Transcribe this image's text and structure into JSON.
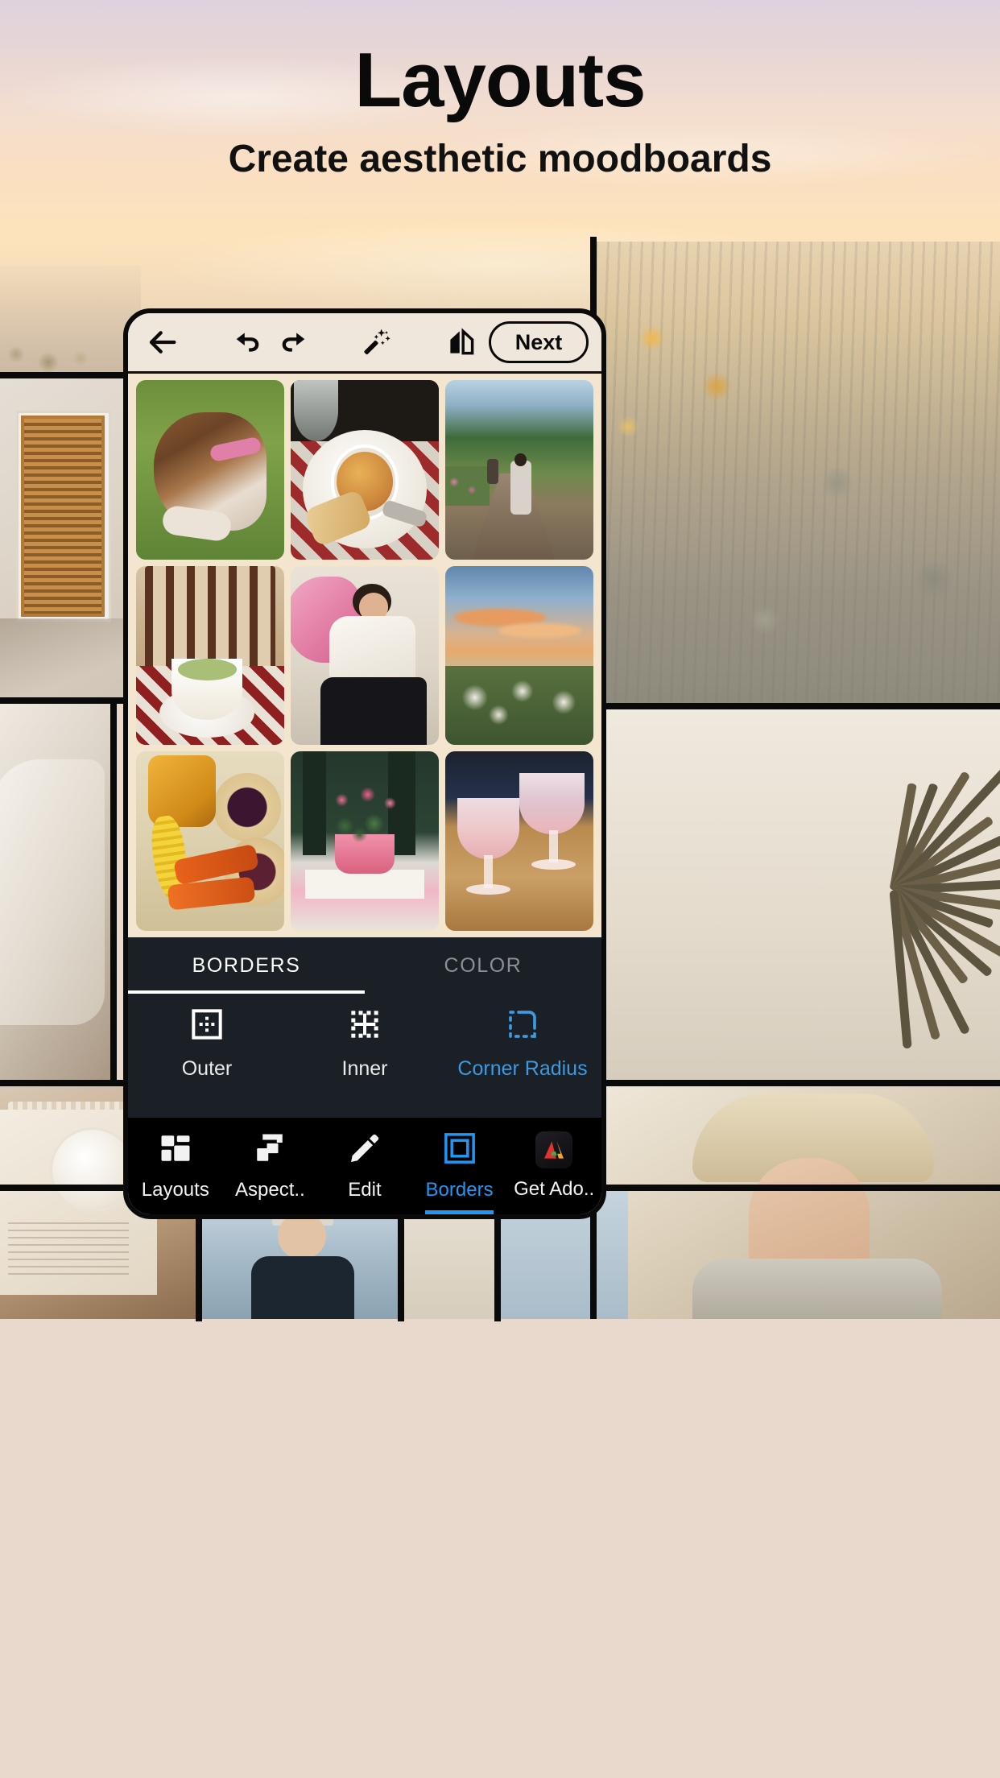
{
  "promo": {
    "title": "Layouts",
    "subtitle": "Create aesthetic moodboards"
  },
  "app": {
    "toolbar": {
      "back_icon": "arrow-left-icon",
      "undo_icon": "undo-icon",
      "redo_icon": "redo-icon",
      "magic_icon": "magic-wand-icon",
      "mirror_icon": "mirror-flip-icon",
      "next_label": "Next"
    },
    "canvas": {
      "layout": "3x3-grid",
      "tiles": [
        {
          "id": "tile-1",
          "subject": "boxer dog on grass"
        },
        {
          "id": "tile-2",
          "subject": "soup bowl on checkered tablecloth"
        },
        {
          "id": "tile-3",
          "subject": "person walking garden path"
        },
        {
          "id": "tile-4",
          "subject": "matcha cup on checkered cloth"
        },
        {
          "id": "tile-5",
          "subject": "woman with pink fairy wings"
        },
        {
          "id": "tile-6",
          "subject": "sunset over hydrangeas"
        },
        {
          "id": "tile-7",
          "subject": "honey jar corn carrots pies"
        },
        {
          "id": "tile-8",
          "subject": "pink geraniums in window"
        },
        {
          "id": "tile-9",
          "subject": "cocktails on wood table"
        }
      ]
    },
    "panel": {
      "tabs": [
        {
          "label": "BORDERS",
          "active": true
        },
        {
          "label": "COLOR",
          "active": false
        }
      ],
      "tools": [
        {
          "label": "Outer",
          "icon": "outer-border-icon",
          "selected": false
        },
        {
          "label": "Inner",
          "icon": "inner-border-icon",
          "selected": false
        },
        {
          "label": "Corner Radius",
          "icon": "corner-radius-icon",
          "selected": true
        }
      ]
    },
    "nav": [
      {
        "label": "Layouts",
        "icon": "layouts-grid-icon",
        "active": false
      },
      {
        "label": "Aspect..",
        "icon": "aspect-ratio-icon",
        "active": false
      },
      {
        "label": "Edit",
        "icon": "pencil-edit-icon",
        "active": false
      },
      {
        "label": "Borders",
        "icon": "borders-square-icon",
        "active": true
      },
      {
        "label": "Get Ado..",
        "icon": "adobe-logo-icon",
        "active": false
      }
    ]
  },
  "colors": {
    "accent_blue": "#2196f3",
    "tool_selected_blue": "#3d9ae0",
    "panel_bg": "#1b2026",
    "nav_bg": "#000000",
    "phone_frame": "#0a0a0a",
    "canvas_bg": "#f4e5cf"
  }
}
